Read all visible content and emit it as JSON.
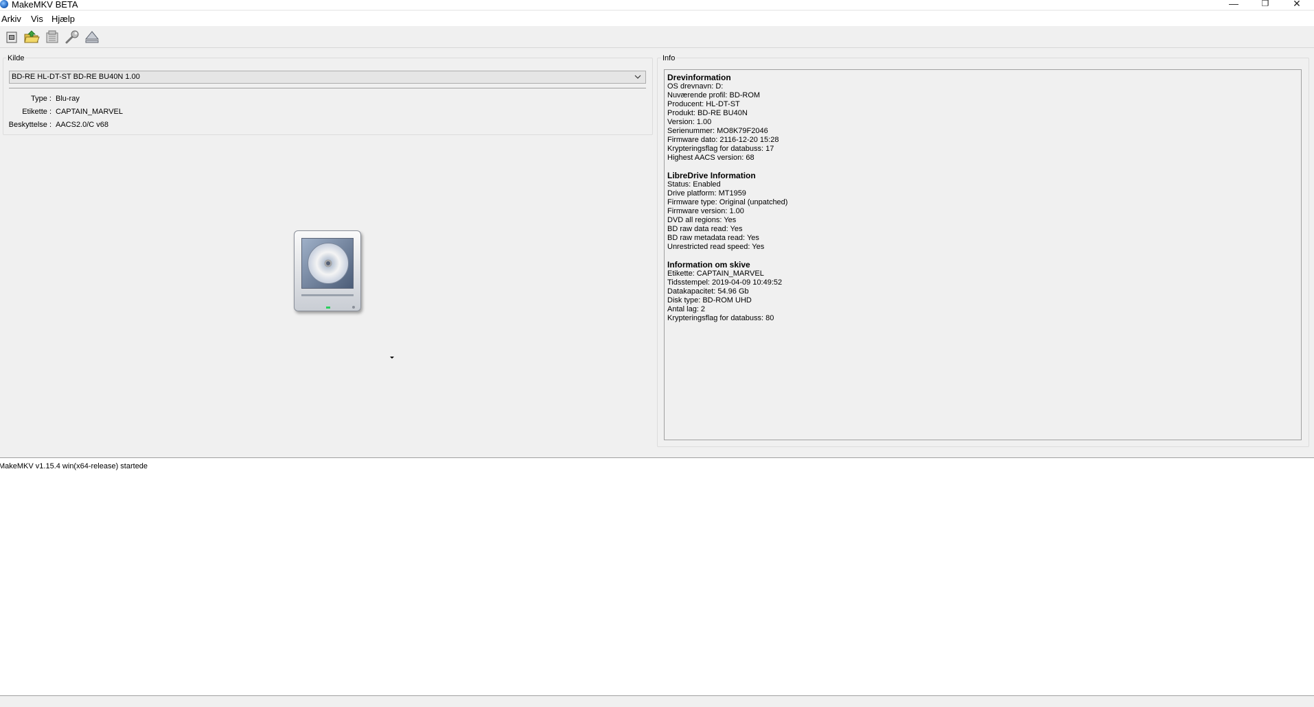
{
  "window": {
    "title": "MakeMKV BETA",
    "controls": {
      "minimize": "—",
      "restore": "❐",
      "close": "✕"
    }
  },
  "menu": {
    "items": [
      "Arkiv",
      "Vis",
      "Hjælp"
    ]
  },
  "toolbar": {
    "buttons": [
      "open-files-icon",
      "open-folder-icon",
      "backup-icon",
      "settings-wrench-icon",
      "eject-icon"
    ]
  },
  "source": {
    "group_title": "Kilde",
    "drive_selected": "BD-RE HL-DT-ST BD-RE BU40N 1.00",
    "properties": [
      {
        "label": "Type :",
        "value": "Blu-ray"
      },
      {
        "label": "Etikette :",
        "value": "CAPTAIN_MARVEL"
      },
      {
        "label": "Beskyttelse :",
        "value": "AACS2.0/C v68"
      }
    ]
  },
  "info": {
    "group_title": "Info",
    "sections": [
      {
        "heading": "Drevinformation",
        "lines": [
          "OS drevnavn: D:",
          "Nuværende profil: BD-ROM",
          "Producent: HL-DT-ST",
          "Produkt: BD-RE BU40N",
          "Version: 1.00",
          "Serienummer: MO8K79F2046",
          "Firmware dato: 2116-12-20 15:28",
          "Krypteringsflag for databuss: 17",
          "Highest AACS version: 68"
        ]
      },
      {
        "heading": "LibreDrive Information",
        "lines": [
          "Status: Enabled",
          "Drive platform: MT1959",
          "Firmware type: Original (unpatched)",
          "Firmware version: 1.00",
          "DVD all regions: Yes",
          "BD raw data read: Yes",
          "BD raw metadata read: Yes",
          "Unrestricted read speed: Yes"
        ]
      },
      {
        "heading": "Information om skive",
        "lines": [
          "Etikette: CAPTAIN_MARVEL",
          "Tidsstempel: 2019-04-09 10:49:52",
          "Datakapacitet: 54.96 Gb",
          "Disk type: BD-ROM UHD",
          "Antal lag: 2",
          "Krypteringsflag for databuss: 80"
        ]
      }
    ]
  },
  "log": {
    "lines": [
      "MakeMKV v1.15.4 win(x64-release) startede"
    ]
  }
}
